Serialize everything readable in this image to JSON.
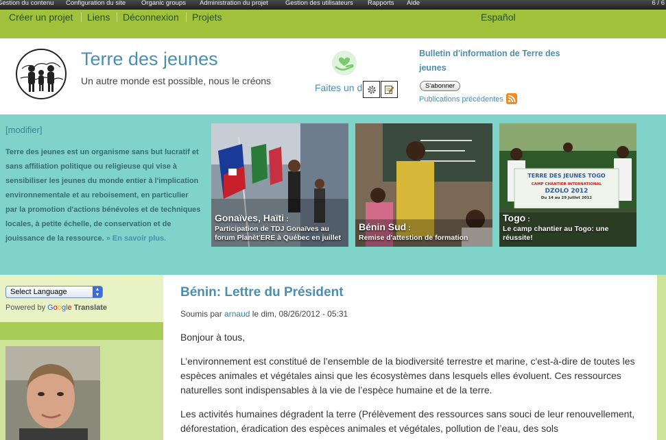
{
  "admin_bar": {
    "items": [
      "Gestion du contenu",
      "Configuration du site",
      "Organic groups",
      "Administration du projet",
      "Gestion des utilisateurs",
      "Rapports",
      "Aide"
    ],
    "counter": "6 / 6"
  },
  "nav": {
    "links": [
      "Créer un projet",
      "Liens",
      "Déconnexion",
      "Projets"
    ],
    "language": "Español"
  },
  "header": {
    "site_title": "Terre des jeunes",
    "slogan": "Un autre monde est possible, nous le créons",
    "donate_text": "Faites un d",
    "newsletter_title": "Bulletin d'information de Terre des jeunes",
    "subscribe_label": "S'abonner",
    "previous_pubs": "Publications précédentes"
  },
  "intro": {
    "modify_link": "[modifier]",
    "text": "Terre des jeunes est un organisme sans but lucratif et sans affiliation politique ou religieuse qui vise à sensibiliser les jeunes du monde entier à l'implication environnementale et au reboisement, en particulier par la promotion d'actions bénévoles et de techniques locales, à petite échelle, de conservation et de jouissance de la ressource.",
    "more_link": "» En savoir plus."
  },
  "features": [
    {
      "place": "Gonaïves, Haïti",
      "desc": "Participation de TDJ Gonaïves au forum Planèt'ERE à Québec en juillet"
    },
    {
      "place": "Bénin Sud",
      "desc": "Remise d'attestion de formation"
    },
    {
      "place": "Togo",
      "desc": "Le camp chantier au Togo: une réussite!",
      "banner": "TERRE DES JEUNES TOGO · CAMP CHANTIER INTERNATIONAL · DZOLO 2012 · Du 14 au 29 Juillet 2012"
    }
  ],
  "sidebar": {
    "language_select": "Select Language",
    "powered_by": "Powered by",
    "google": [
      "G",
      "o",
      "o",
      "g",
      "l",
      "e"
    ],
    "translate": "Translate"
  },
  "article": {
    "title": "Bénin: Lettre du Président",
    "submitted_prefix": "Soumis par",
    "author": "arnaud",
    "date": "le dim, 08/26/2012 - 05:31",
    "paragraphs": [
      "Bonjour à tous,",
      "L’environnement est constitué de l’ensemble de la biodiversité terrestre et marine, c'est-à-dire de toutes les espèces animales et végétales ainsi que les écosystèmes dans lesquels elles évoluent. Ces ressources naturelles sont indispensables à la vie de l’espèce humaine et de la terre.",
      "Les activités humaines dégradent la terre (Prélèvement des ressources sans souci de leur renouvellement, déforestation, éradication des espèces animales et végétales, pollution de l’eau, des sols"
    ]
  },
  "colors": {
    "teal_band": "#7fd3c9",
    "nav_green": "#9fc23a",
    "link_blue": "#4a8fb0",
    "sidebar_green": "#cde39a"
  }
}
